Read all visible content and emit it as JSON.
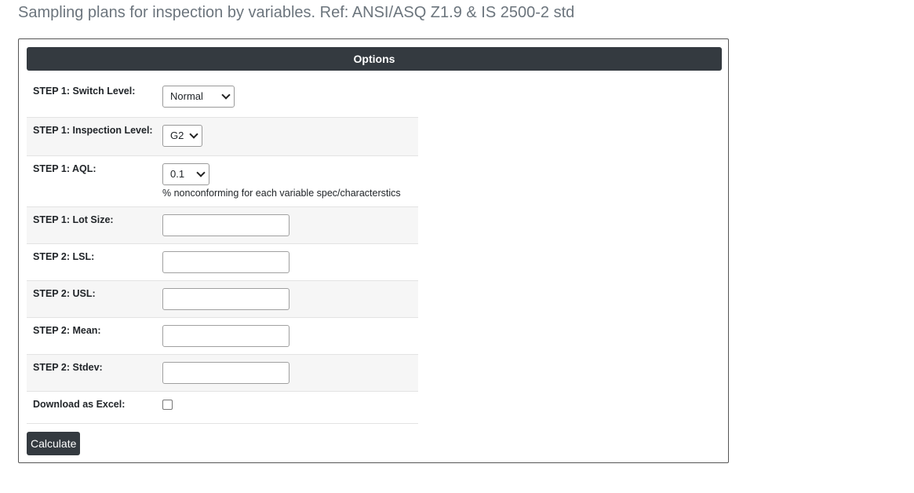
{
  "page": {
    "title": "Sampling plans for inspection by variables. Ref: ANSI/ASQ Z1.9 & IS 2500-2 std"
  },
  "card": {
    "header": "Options"
  },
  "form": {
    "switch_level": {
      "label": "STEP 1: Switch Level:",
      "value": "Normal"
    },
    "inspection_level": {
      "label": "STEP 1: Inspection Level:",
      "value": "G2"
    },
    "aql": {
      "label": "STEP 1: AQL:",
      "value": "0.1",
      "hint": "% nonconforming for each variable spec/characterstics"
    },
    "lot_size": {
      "label": "STEP 1: Lot Size:",
      "value": ""
    },
    "lsl": {
      "label": "STEP 2: LSL:",
      "value": ""
    },
    "usl": {
      "label": "STEP 2: USL:",
      "value": ""
    },
    "mean": {
      "label": "STEP 2: Mean:",
      "value": ""
    },
    "stdev": {
      "label": "STEP 2: Stdev:",
      "value": ""
    },
    "download_excel": {
      "label": "Download as Excel:",
      "checked": false
    }
  },
  "actions": {
    "calculate_label": "Calculate"
  },
  "colors": {
    "header_bg": "#343a40",
    "button_bg": "#343a40",
    "title_text": "#6c757d",
    "alt_row_bg": "#f6f6f6"
  }
}
